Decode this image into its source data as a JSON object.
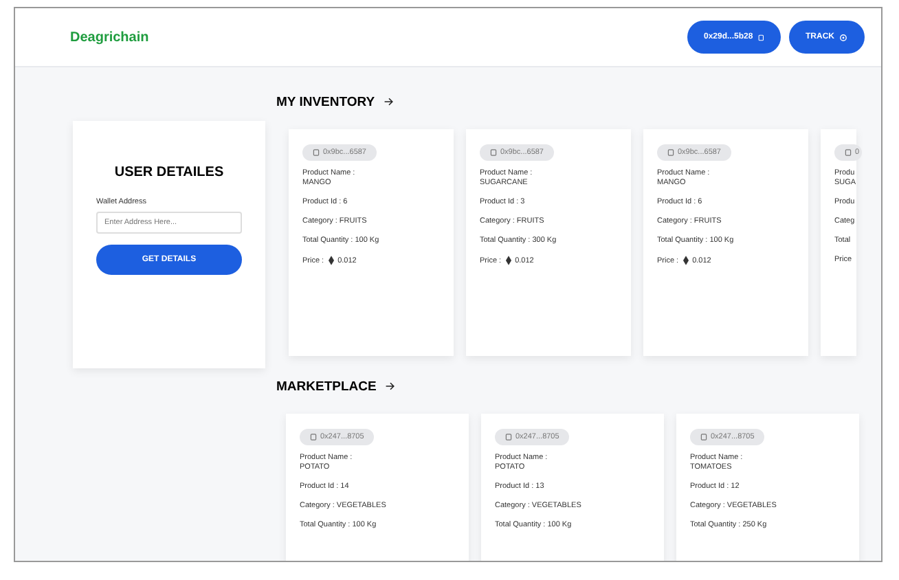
{
  "header": {
    "brand": "Deagrichain",
    "wallet_button": "0x29d...5b28",
    "track_button": "TRACK"
  },
  "user_card": {
    "title": "USER DETAILES",
    "field_label": "Wallet Address",
    "placeholder": "Enter Address Here...",
    "button": "GET DETAILS"
  },
  "inventory": {
    "title": "MY INVENTORY",
    "cards": [
      {
        "kind": "full",
        "address": "0x9bc...6587",
        "name_label": "Product Name :",
        "name": "MANGO",
        "id_line": "Product Id : 6",
        "category_line": "Category : FRUITS",
        "quantity_line": "Total Quantity : 100 Kg",
        "price_label": "Price :",
        "price": "0.012"
      },
      {
        "kind": "full",
        "address": "0x9bc...6587",
        "name_label": "Product Name :",
        "name": "SUGARCANE",
        "id_line": "Product Id : 3",
        "category_line": "Category : FRUITS",
        "quantity_line": "Total Quantity : 300 Kg",
        "price_label": "Price :",
        "price": "0.012"
      },
      {
        "kind": "full",
        "address": "0x9bc...6587",
        "name_label": "Product Name :",
        "name": "MANGO",
        "id_line": "Product Id : 6",
        "category_line": "Category : FRUITS",
        "quantity_line": "Total Quantity : 100 Kg",
        "price_label": "Price :",
        "price": "0.012"
      },
      {
        "kind": "cut",
        "address": "0",
        "name_label": "Produ",
        "name": "SUGA",
        "id_line": "Produ",
        "category_line": "Categ",
        "quantity_line": "Total",
        "price_label": "Price"
      }
    ]
  },
  "marketplace": {
    "title": "MARKETPLACE",
    "cards": [
      {
        "address": "0x247...8705",
        "name_label": "Product Name :",
        "name": "POTATO",
        "id_line": "Product Id : 14",
        "category_line": "Category : VEGETABLES",
        "quantity_line": "Total Quantity : 100 Kg"
      },
      {
        "address": "0x247...8705",
        "name_label": "Product Name :",
        "name": "POTATO",
        "id_line": "Product Id : 13",
        "category_line": "Category : VEGETABLES",
        "quantity_line": "Total Quantity : 100 Kg"
      },
      {
        "address": "0x247...8705",
        "name_label": "Product Name :",
        "name": "TOMATOES",
        "id_line": "Product Id : 12",
        "category_line": "Category : VEGETABLES",
        "quantity_line": "Total Quantity : 250 Kg"
      }
    ]
  }
}
